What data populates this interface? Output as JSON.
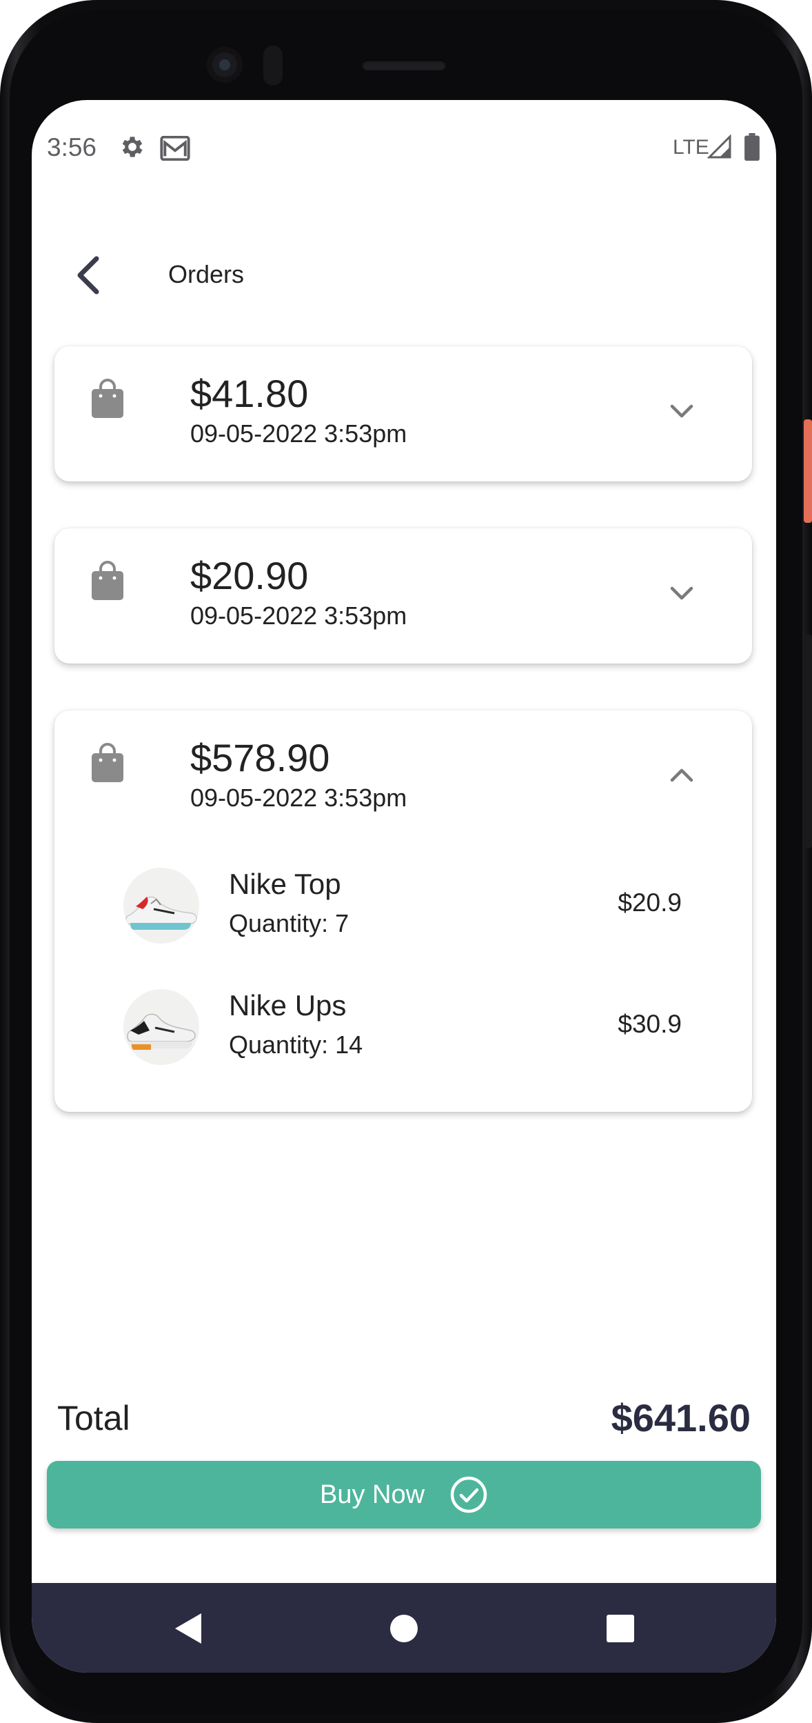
{
  "status_bar": {
    "time": "3:56",
    "network": "LTE",
    "icons": [
      "gear-icon",
      "gmail-icon",
      "signal-icon",
      "battery-icon"
    ]
  },
  "app_bar": {
    "title": "Orders",
    "back_icon": "chevron-left-icon"
  },
  "orders": [
    {
      "amount": "$41.80",
      "date": "09-05-2022 3:53pm",
      "expanded": false
    },
    {
      "amount": "$20.90",
      "date": "09-05-2022 3:53pm",
      "expanded": false
    },
    {
      "amount": "$578.90",
      "date": "09-05-2022 3:53pm",
      "expanded": true,
      "items": [
        {
          "name": "Nike Top",
          "quantity": "Quantity: 7",
          "price": "$20.9"
        },
        {
          "name": "Nike Ups",
          "quantity": "Quantity: 14",
          "price": "$30.9"
        }
      ]
    }
  ],
  "summary": {
    "total_label": "Total",
    "total_value": "$641.60"
  },
  "buy_button": {
    "label": "Buy Now"
  },
  "colors": {
    "accent": "#4db59b",
    "total_text": "#2a2c42",
    "nav_bar": "#2b2c41",
    "icon_grey": "#8a8a8a"
  }
}
